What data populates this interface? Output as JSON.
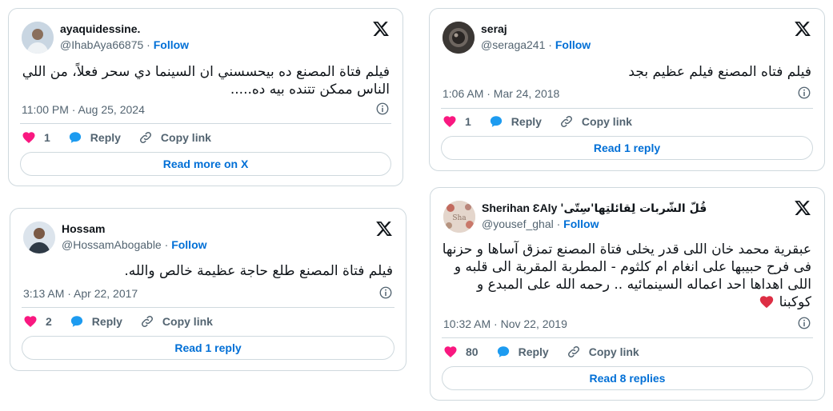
{
  "colors": {
    "heart": "#f91880",
    "reply": "#1d9bf0",
    "link": "#006fd6",
    "muted": "#536471",
    "border": "#cfd9de"
  },
  "icons": [
    "x-logo-icon",
    "info-icon",
    "heart-icon",
    "reply-bubble-icon",
    "link-icon",
    "red-heart-emoji"
  ],
  "tweets": [
    {
      "name": "ayaquidessine.",
      "handle": "@IhabAya66875",
      "follow": "Follow",
      "text": "فيلم فتاة المصنع ده بيحسسني ان السينما دي سحر فعلاً، من اللي الناس ممكن تتنده بيه ده.....",
      "timestamp": "11:00 PM · Aug 25, 2024",
      "likes": "1",
      "reply": "Reply",
      "copy_link": "Copy link",
      "button": "Read more on X"
    },
    {
      "name": "seraj",
      "handle": "@seraga241",
      "follow": "Follow",
      "text": "فيلم فتاه المصنع فيلم عظيم بجد",
      "timestamp": "1:06 AM · Mar 24, 2018",
      "likes": "1",
      "reply": "Reply",
      "copy_link": "Copy link",
      "button": "Read 1 reply"
    },
    {
      "name": "Hossam",
      "handle": "@HossamAbogable",
      "follow": "Follow",
      "text": "فيلم فتاة المصنع طلع حاجة عظيمة خالص والله.",
      "timestamp": "3:13 AM · Apr 22, 2017",
      "likes": "2",
      "reply": "Reply",
      "copy_link": "Copy link",
      "button": "Read 1 reply"
    },
    {
      "name": "Sherihan ƐAly",
      "name_suffix": "قُلّ الشّربات لِقائلتِها'سِتّى'",
      "handle": "@yousef_ghal",
      "follow": "Follow",
      "text": "عبقرية محمد خان اللى قدر يخلى فتاة المصنع تمزق آساها و حزنها فى فرح حبيبها على انغام ام كلثوم - المطربة المقربة الى قلبه و اللى اهداها احد اعماله السينمائيه .. رحمه الله على المبدع و كوكبنا",
      "avatar_text": "Sha",
      "timestamp": "10:32 AM · Nov 22, 2019",
      "likes": "80",
      "reply": "Reply",
      "copy_link": "Copy link",
      "button": "Read 8 replies"
    }
  ]
}
